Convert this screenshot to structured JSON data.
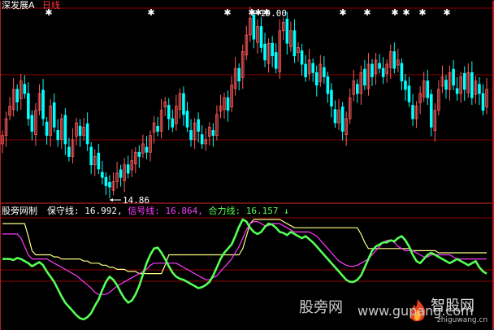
{
  "header": {
    "stock_name": "深发展A",
    "period": "日线"
  },
  "price_panel": {
    "high_label": "19.00",
    "low_label": "14.86",
    "sell_markers": [
      60,
      186,
      280,
      310,
      318,
      328,
      422,
      452,
      486,
      500,
      520,
      550
    ],
    "closes": [
      16.2,
      16.6,
      16.9,
      17.3,
      17.0,
      17.5,
      17.2,
      16.6,
      16.3,
      16.8,
      17.2,
      16.6,
      16.2,
      16.9,
      16.4,
      16.1,
      16.6,
      16.0,
      15.7,
      16.1,
      16.5,
      16.2,
      16.4,
      16.0,
      15.5,
      15.7,
      15.4,
      15.2,
      15.0,
      14.97,
      15.1,
      15.3,
      15.2,
      15.5,
      15.3,
      15.6,
      15.8,
      15.7,
      16.0,
      15.8,
      16.2,
      16.5,
      16.3,
      16.8,
      17.0,
      16.6,
      16.4,
      16.9,
      17.2,
      16.7,
      16.4,
      16.1,
      16.5,
      16.3,
      16.0,
      16.1,
      16.4,
      16.2,
      16.7,
      16.9,
      17.1,
      16.8,
      17.4,
      17.8,
      17.5,
      18.2,
      18.6,
      19.0,
      18.5,
      18.8,
      18.3,
      18.0,
      18.4,
      18.1,
      17.8,
      18.7,
      18.9,
      18.4,
      18.7,
      18.1,
      18.3,
      17.9,
      17.6,
      18.0,
      17.7,
      17.4,
      17.9,
      17.6,
      17.2,
      16.9,
      16.5,
      16.8,
      16.3,
      16.6,
      17.1,
      17.5,
      17.2,
      17.7,
      17.4,
      17.9,
      17.6,
      18.0,
      17.8,
      17.6,
      17.9,
      18.2,
      17.8,
      18.0,
      17.5,
      17.3,
      17.0,
      16.6,
      16.9,
      17.2,
      17.5,
      17.1,
      16.4,
      16.8,
      17.3,
      17.6,
      17.3,
      17.7,
      17.4,
      17.2,
      17.6,
      17.3,
      17.7,
      17.1,
      17.5,
      17.2,
      16.8,
      17.3
    ]
  },
  "indicator_panel": {
    "name": "股旁网制",
    "baoshou_label": "保守线:",
    "baoshou_value": "16.992,",
    "xinhao_label": "信号线:",
    "xinhao_value": "16.864,",
    "heli_label": "合力线:",
    "heli_value": "16.157",
    "arrow": "↓",
    "heli_series": [
      0.62,
      0.62,
      0.62,
      0.61,
      0.63,
      0.62,
      0.6,
      0.58,
      0.55,
      0.57,
      0.59,
      0.56,
      0.5,
      0.45,
      0.4,
      0.33,
      0.26,
      0.2,
      0.16,
      0.12,
      0.08,
      0.05,
      0.04,
      0.06,
      0.1,
      0.17,
      0.23,
      0.32,
      0.4,
      0.45,
      0.42,
      0.37,
      0.3,
      0.24,
      0.2,
      0.22,
      0.28,
      0.36,
      0.47,
      0.58,
      0.66,
      0.72,
      0.73,
      0.68,
      0.62,
      0.55,
      0.49,
      0.45,
      0.43,
      0.42,
      0.4,
      0.38,
      0.36,
      0.34,
      0.35,
      0.37,
      0.4,
      0.46,
      0.54,
      0.62,
      0.68,
      0.72,
      0.76,
      0.84,
      0.93,
      1.0,
      0.98,
      0.92,
      0.88,
      0.86,
      0.88,
      0.93,
      0.96,
      0.95,
      0.92,
      0.88,
      0.87,
      0.85,
      0.88,
      0.86,
      0.84,
      0.82,
      0.84,
      0.81,
      0.78,
      0.74,
      0.7,
      0.66,
      0.62,
      0.58,
      0.54,
      0.5,
      0.46,
      0.42,
      0.4,
      0.4,
      0.42,
      0.46,
      0.54,
      0.62,
      0.7,
      0.74,
      0.76,
      0.78,
      0.78,
      0.8,
      0.79,
      0.82,
      0.84,
      0.8,
      0.74,
      0.66,
      0.6,
      0.58,
      0.62,
      0.66,
      0.68,
      0.66,
      0.64,
      0.62,
      0.6,
      0.58,
      0.6,
      0.62,
      0.6,
      0.58,
      0.56,
      0.58,
      0.6,
      0.54,
      0.5,
      0.48
    ],
    "xinhao_series": [
      0.86,
      0.86,
      0.86,
      0.86,
      0.86,
      0.82,
      0.74,
      0.66,
      0.62,
      0.62,
      0.62,
      0.62,
      0.62,
      0.6,
      0.58,
      0.56,
      0.54,
      0.52,
      0.5,
      0.48,
      0.46,
      0.43,
      0.4,
      0.37,
      0.34,
      0.3,
      0.28,
      0.28,
      0.28,
      0.3,
      0.33,
      0.36,
      0.38,
      0.4,
      0.42,
      0.44,
      0.46,
      0.48,
      0.5,
      0.52,
      0.56,
      0.58,
      0.58,
      0.58,
      0.58,
      0.58,
      0.58,
      0.58,
      0.56,
      0.54,
      0.52,
      0.5,
      0.48,
      0.46,
      0.44,
      0.42,
      0.42,
      0.44,
      0.46,
      0.5,
      0.54,
      0.58,
      0.62,
      0.68,
      0.74,
      0.82,
      0.9,
      0.96,
      0.98,
      0.98,
      0.96,
      0.94,
      0.94,
      0.96,
      0.96,
      0.96,
      0.94,
      0.92,
      0.9,
      0.88,
      0.88,
      0.88,
      0.88,
      0.88,
      0.86,
      0.84,
      0.8,
      0.76,
      0.72,
      0.68,
      0.64,
      0.6,
      0.58,
      0.56,
      0.55,
      0.55,
      0.56,
      0.58,
      0.6,
      0.62,
      0.66,
      0.7,
      0.74,
      0.78,
      0.8,
      0.8,
      0.78,
      0.74,
      0.72,
      0.7,
      0.7,
      0.7,
      0.68,
      0.66,
      0.64,
      0.64,
      0.66,
      0.66,
      0.66,
      0.66,
      0.66,
      0.66,
      0.64,
      0.62,
      0.62,
      0.62,
      0.62,
      0.62,
      0.62,
      0.62,
      0.62,
      0.62
    ],
    "baoshou_series": [
      0.96,
      0.96,
      0.96,
      0.96,
      0.96,
      0.96,
      0.96,
      0.84,
      0.7,
      0.66,
      0.66,
      0.66,
      0.66,
      0.66,
      0.64,
      0.64,
      0.62,
      0.62,
      0.62,
      0.62,
      0.62,
      0.62,
      0.6,
      0.6,
      0.58,
      0.58,
      0.58,
      0.56,
      0.56,
      0.54,
      0.54,
      0.52,
      0.52,
      0.52,
      0.5,
      0.5,
      0.5,
      0.48,
      0.48,
      0.48,
      0.48,
      0.48,
      0.48,
      0.48,
      0.56,
      0.66,
      0.66,
      0.66,
      0.66,
      0.66,
      0.66,
      0.66,
      0.66,
      0.66,
      0.66,
      0.66,
      0.66,
      0.66,
      0.66,
      0.66,
      0.66,
      0.66,
      0.66,
      0.66,
      0.66,
      0.72,
      0.84,
      0.96,
      1.0,
      1.0,
      1.0,
      1.0,
      1.0,
      1.0,
      1.0,
      1.0,
      0.98,
      0.96,
      0.94,
      0.92,
      0.92,
      0.92,
      0.92,
      0.92,
      0.92,
      0.92,
      0.92,
      0.92,
      0.92,
      0.92,
      0.92,
      0.92,
      0.92,
      0.92,
      0.92,
      0.92,
      0.92,
      0.86,
      0.78,
      0.72,
      0.72,
      0.72,
      0.72,
      0.72,
      0.72,
      0.72,
      0.72,
      0.72,
      0.72,
      0.72,
      0.72,
      0.7,
      0.7,
      0.7,
      0.7,
      0.7,
      0.7,
      0.7,
      0.68,
      0.68,
      0.68,
      0.68,
      0.68,
      0.68,
      0.68,
      0.68,
      0.68,
      0.68,
      0.68,
      0.68,
      0.68,
      0.68
    ]
  },
  "watermark": {
    "site": "股旁网",
    "url": "www.gupang.com",
    "brand": "智股网",
    "domain": "zhiguwang.cn"
  },
  "colors": {
    "up": "#ff5a5a",
    "down": "#00ffff",
    "grid": "#8b0000",
    "heli": "#55ff55",
    "xinhao": "#ff3cff",
    "baoshou": "#ffff88",
    "text_label": "#ffffff"
  }
}
